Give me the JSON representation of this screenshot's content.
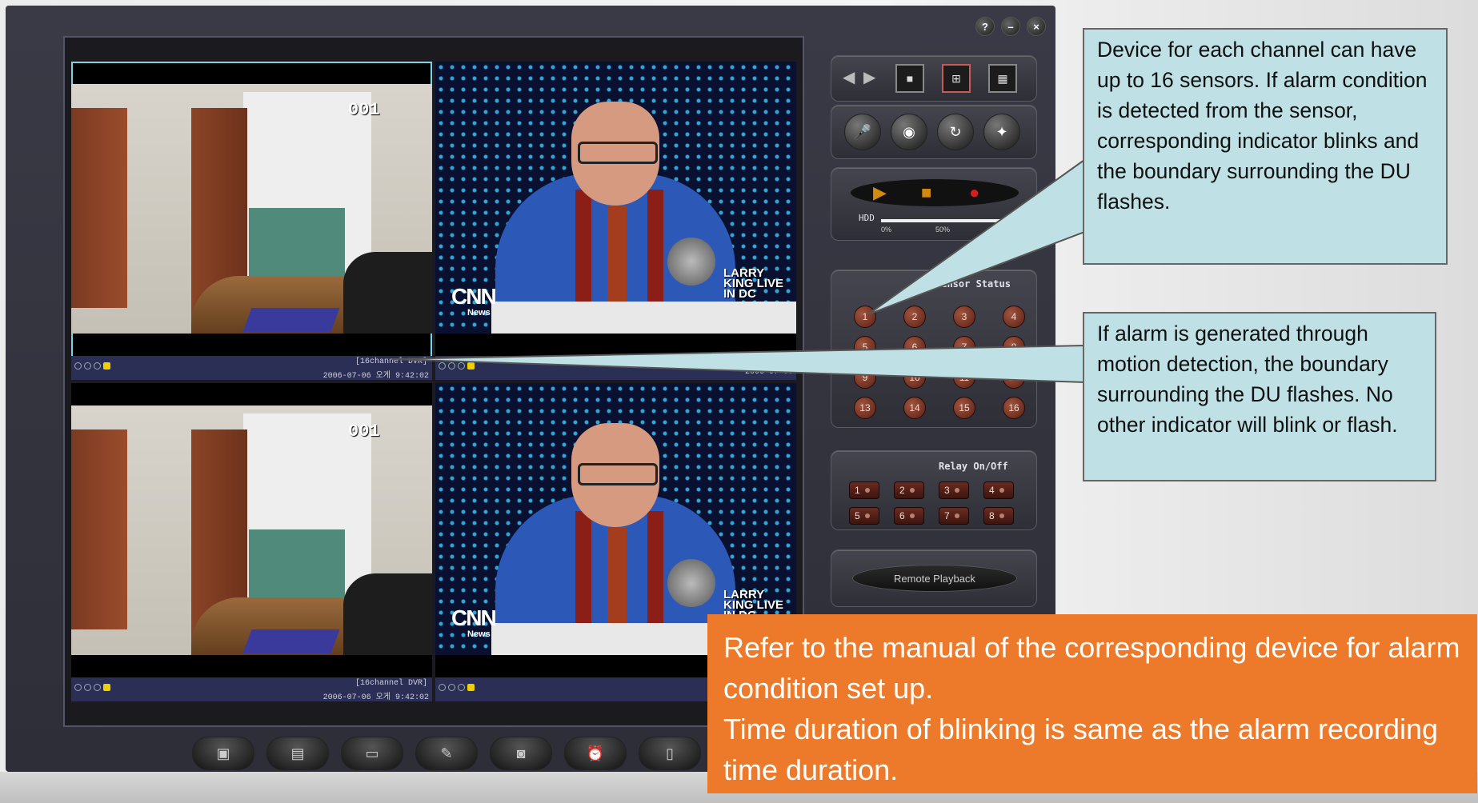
{
  "window_controls": [
    "?",
    "–",
    "×"
  ],
  "cameras": [
    {
      "type": "office",
      "overlay": "001",
      "dvr": "[16channel DVR]",
      "timestamp": "2006-07-06 오게 9:42:02",
      "selected": true
    },
    {
      "type": "news",
      "logo": "CNN",
      "logo_sub": "News",
      "show_text": "LARRY KING LIVE IN DC",
      "dvr": "",
      "timestamp": "2006-07-06"
    },
    {
      "type": "office",
      "overlay": "001",
      "dvr": "[16channel DVR]",
      "timestamp": "2006-07-06 오게 9:42:02",
      "selected": false
    },
    {
      "type": "news",
      "logo": "CNN",
      "logo_sub": "News",
      "show_text": "LARRY KING LIVE IN DC",
      "dvr": "",
      "timestamp": "2006-07-0"
    }
  ],
  "panel": {
    "view_controls": [
      "◀",
      "▶",
      "■",
      "⊞",
      "▦"
    ],
    "tool_icons": [
      "mic-icon",
      "camera-icon",
      "refresh-icon",
      "magic-icon"
    ],
    "playback": {
      "hdd_label": "HDD",
      "hdd_ticks": [
        "0%",
        "50%"
      ]
    },
    "sensor_title": "Sensor Status",
    "sensors": [
      "1",
      "2",
      "3",
      "4",
      "5",
      "6",
      "7",
      "8",
      "9",
      "10",
      "11",
      "12",
      "13",
      "14",
      "15",
      "16"
    ],
    "relay_title": "Relay On/Off",
    "relays": [
      "1",
      "2",
      "3",
      "4",
      "5",
      "6",
      "7",
      "8"
    ],
    "remote_playback": "Remote Playback"
  },
  "toolbar": [
    "capture-icon",
    "save-icon",
    "folder-icon",
    "edit-icon",
    "video-icon",
    "alarm-icon",
    "settings-icon"
  ],
  "callout_sensor": "Device for each channel can have up to 16 sensors. If alarm condition is detected from the sensor, corresponding indicator blinks and the boundary surrounding the DU flashes.",
  "callout_motion": "If alarm is generated through motion detection, the boundary surrounding the DU flashes. No other indicator will blink or flash.",
  "note_lines": [
    "Refer to the manual of the corresponding device for alarm condition set up.",
    "Time duration of blinking is same as the alarm recording time duration."
  ],
  "colors": {
    "callout_bg": "#bfe0e4",
    "note_bg": "#ec7a2a",
    "selected_border": "#7ad3e0"
  }
}
